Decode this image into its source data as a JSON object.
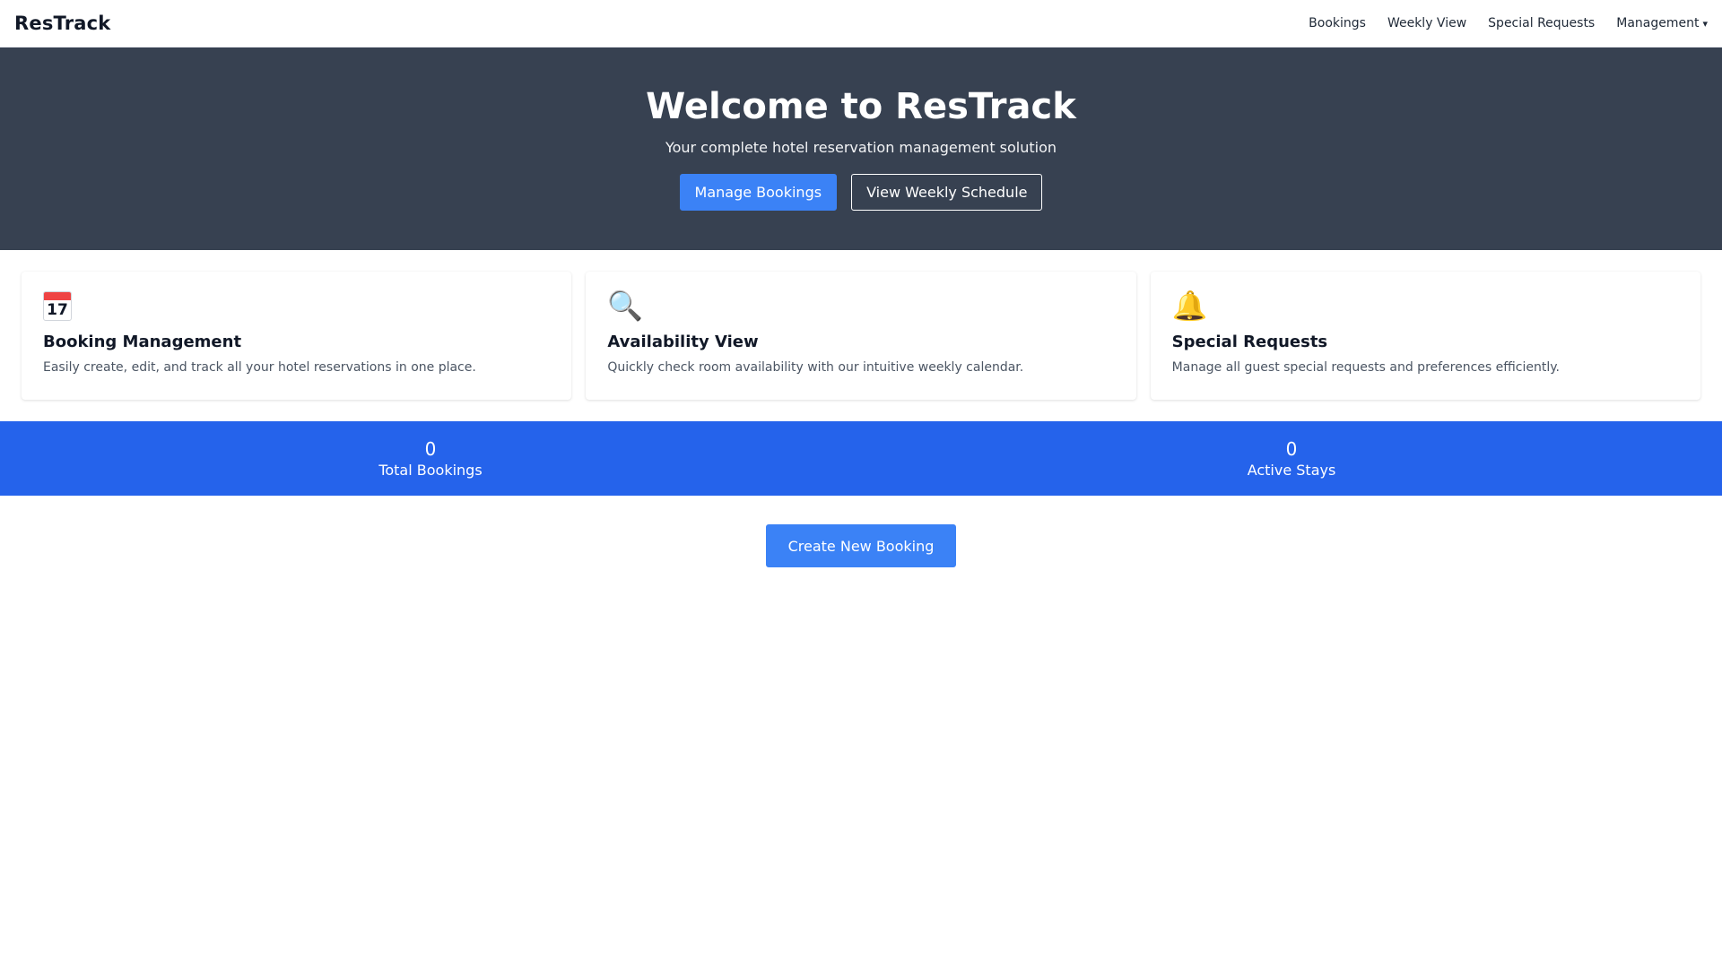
{
  "navbar": {
    "brand": "ResTrack",
    "links": [
      {
        "label": "Bookings"
      },
      {
        "label": "Weekly View"
      },
      {
        "label": "Special Requests"
      }
    ],
    "dropdown": {
      "label": "Management",
      "caret": "▾"
    }
  },
  "hero": {
    "title": "Welcome to ResTrack",
    "subtitle": "Your complete hotel reservation management solution",
    "primary_button": "Manage Bookings",
    "secondary_button": "View Weekly Schedule"
  },
  "features": [
    {
      "icon": "calendar-icon",
      "icon_text": "17",
      "title": "Booking Management",
      "description": "Easily create, edit, and track all your hotel reservations in one place."
    },
    {
      "icon": "magnifier-icon",
      "icon_glyph": "🔍",
      "title": "Availability View",
      "description": "Quickly check room availability with our intuitive weekly calendar."
    },
    {
      "icon": "bell-icon",
      "icon_glyph": "🔔",
      "title": "Special Requests",
      "description": "Manage all guest special requests and preferences efficiently."
    }
  ],
  "stats": [
    {
      "value": "0",
      "label": "Total Bookings"
    },
    {
      "value": "0",
      "label": "Active Stays"
    }
  ],
  "cta": {
    "label": "Create New Booking"
  },
  "colors": {
    "hero_bg": "#374151",
    "primary": "#3b82f6",
    "stats_bg": "#2563eb"
  }
}
